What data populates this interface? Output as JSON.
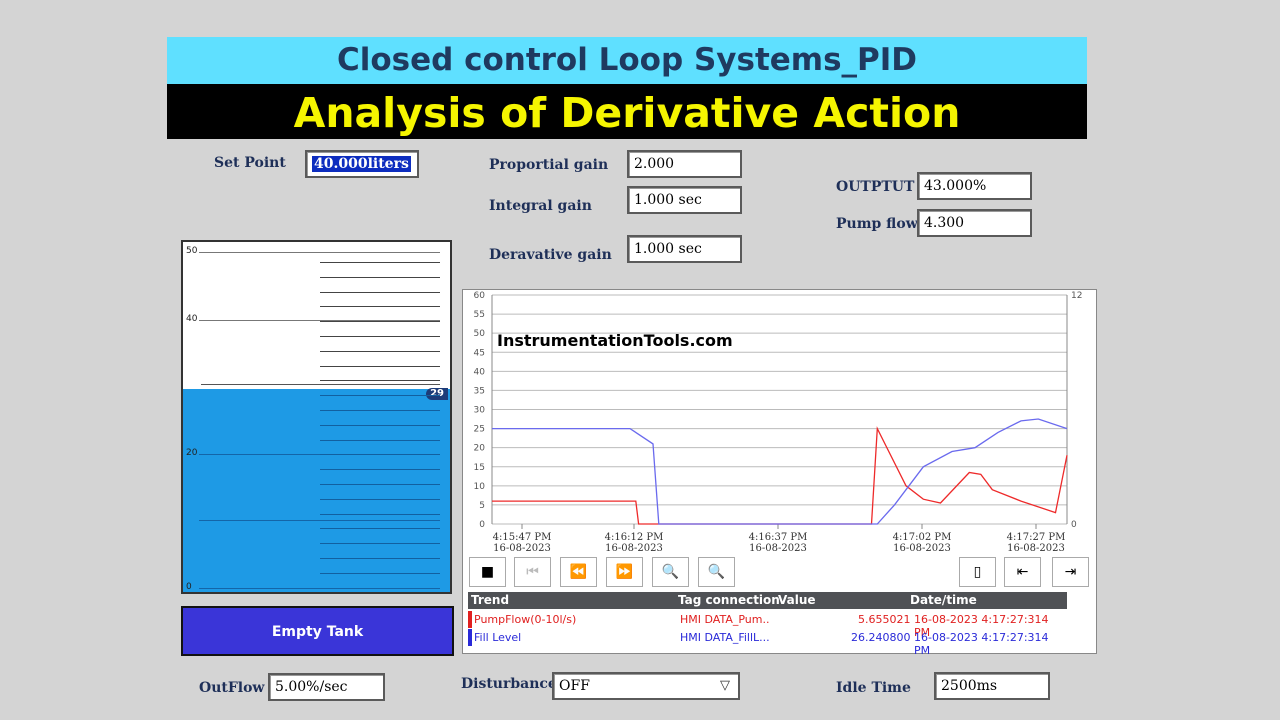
{
  "header": {
    "title": "Closed control Loop Systems_PID",
    "subtitle": "Analysis of Derivative Action"
  },
  "setpoint": {
    "label": "Set Point",
    "value": "40.000liters"
  },
  "gains": {
    "proportional_label": "Proportial gain",
    "proportional_value": "2.000",
    "integral_label": "Integral gain",
    "integral_value": "1.000 sec",
    "derivative_label": "Deravative gain",
    "derivative_value": "1.000 sec"
  },
  "outputs": {
    "output_label": "OUTPTUT",
    "output_value": "43.000%",
    "pump_label": "Pump flow",
    "pump_value": "4.300"
  },
  "tank": {
    "ticks": [
      "50",
      "40",
      "20",
      "0"
    ],
    "level_badge": "29",
    "level_fraction": 0.58,
    "fill_color": "#1e9ae5"
  },
  "empty_tank_button": "Empty Tank",
  "watermark": "InstrumentationTools.com",
  "trend": {
    "left_axis": [
      "60",
      "55",
      "50",
      "45",
      "40",
      "35",
      "30",
      "25",
      "20",
      "15",
      "10",
      "5",
      "0"
    ],
    "right_axis_top": "12",
    "right_axis_bottom": "0",
    "time_labels": [
      {
        "time": "4:15:47 PM",
        "date": "16-08-2023"
      },
      {
        "time": "4:16:12 PM",
        "date": "16-08-2023"
      },
      {
        "time": "4:16:37 PM",
        "date": "16-08-2023"
      },
      {
        "time": "4:17:02 PM",
        "date": "16-08-2023"
      },
      {
        "time": "4:17:27 PM",
        "date": "16-08-2023"
      }
    ],
    "toolbar_icons": [
      "stop-icon",
      "first-icon",
      "rewind-icon",
      "forward-icon",
      "zoom-in-icon",
      "zoom-out-icon",
      "ruler-icon",
      "ruler-back-icon",
      "ruler-forward-icon"
    ],
    "table_headers": {
      "trend": "Trend",
      "tag": "Tag connection",
      "value": "Value",
      "datetime": "Date/time"
    },
    "rows": [
      {
        "trend": "PumpFlow(0-10l/s)",
        "tag": "HMI DATA_Pum..",
        "value": "5.655021",
        "datetime": "16-08-2023 4:17:27:314 PM",
        "color": "#e02020"
      },
      {
        "trend": "Fill Level",
        "tag": "HMI DATA_FillL...",
        "value": "26.240800",
        "datetime": "16-08-2023 4:17:27:314 PM",
        "color": "#2a2ad8"
      }
    ],
    "colors": {
      "pump": "#ee2a2a",
      "level": "#6a6aee"
    }
  },
  "chart_data": {
    "type": "line",
    "x": [
      "4:15:47 PM",
      "4:16:12 PM",
      "4:16:37 PM",
      "4:17:02 PM",
      "4:17:27 PM"
    ],
    "yleft_range": [
      0,
      60
    ],
    "yright_range": [
      0,
      12
    ],
    "grid": true,
    "series": [
      {
        "name": "PumpFlow(0-10l/s)",
        "axis": "right",
        "points": [
          [
            0,
            1.2
          ],
          [
            25,
            1.2
          ],
          [
            25.5,
            0
          ],
          [
            66,
            0
          ],
          [
            67,
            5
          ],
          [
            72,
            2
          ],
          [
            75,
            1.3
          ],
          [
            78,
            1.1
          ],
          [
            83,
            2.7
          ],
          [
            85,
            2.6
          ],
          [
            87,
            1.8
          ],
          [
            92,
            1.2
          ],
          [
            98,
            0.6
          ],
          [
            100,
            3.6
          ]
        ]
      },
      {
        "name": "Fill Level",
        "axis": "left",
        "points": [
          [
            0,
            25
          ],
          [
            24,
            25
          ],
          [
            28,
            21
          ],
          [
            29,
            0
          ],
          [
            67,
            0
          ],
          [
            70,
            5
          ],
          [
            75,
            15
          ],
          [
            80,
            19
          ],
          [
            84,
            20
          ],
          [
            88,
            24
          ],
          [
            92,
            27
          ],
          [
            95,
            27.5
          ],
          [
            100,
            25
          ]
        ]
      }
    ]
  },
  "outflow": {
    "label": "OutFlow",
    "value": "5.00%/sec"
  },
  "disturbance": {
    "label": "Disturbance",
    "value": "OFF"
  },
  "idle": {
    "label": "Idle Time",
    "value": "2500ms"
  }
}
